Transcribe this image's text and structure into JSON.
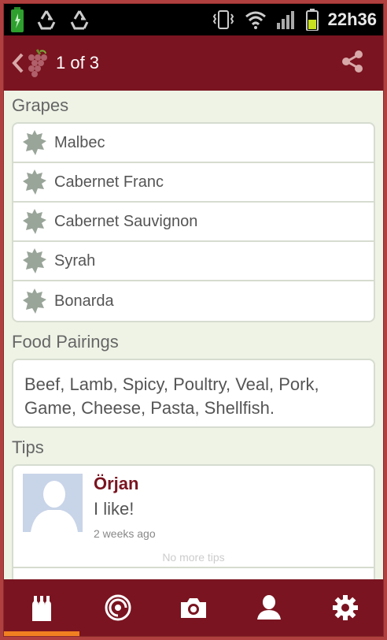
{
  "status_bar": {
    "time": "22h36",
    "icons": [
      "battery-charging-icon",
      "recycle-icon",
      "recycle-icon",
      "vibrate-icon",
      "wifi-icon",
      "signal-icon",
      "battery-icon"
    ]
  },
  "app_bar": {
    "title": "1 of 3",
    "icons": [
      "back-chevron-icon",
      "grapes-logo-icon",
      "share-icon"
    ]
  },
  "grapes": {
    "title": "Grapes",
    "items": [
      {
        "label": "Malbec"
      },
      {
        "label": "Cabernet Franc"
      },
      {
        "label": "Cabernet Sauvignon"
      },
      {
        "label": "Syrah"
      },
      {
        "label": "Bonarda"
      }
    ]
  },
  "food_pairings": {
    "title": "Food Pairings",
    "text": "Beef, Lamb, Spicy, Poultry, Veal, Pork, Game, Cheese, Pasta, Shellfish."
  },
  "tips": {
    "title": "Tips",
    "items": [
      {
        "author": "Örjan",
        "text": "I like!",
        "time": "2 weeks ago"
      }
    ],
    "no_more": "No more tips"
  },
  "bottom_nav": {
    "items": [
      "wine-bottles-icon",
      "wine-scan-icon",
      "camera-icon",
      "profile-icon",
      "settings-gear-icon"
    ],
    "active": "wine-bottles-icon"
  },
  "colors": {
    "app_bar": "#7a1420",
    "background": "#eef3e6",
    "accent_indicator": "#f08020",
    "author": "#7a1420"
  }
}
